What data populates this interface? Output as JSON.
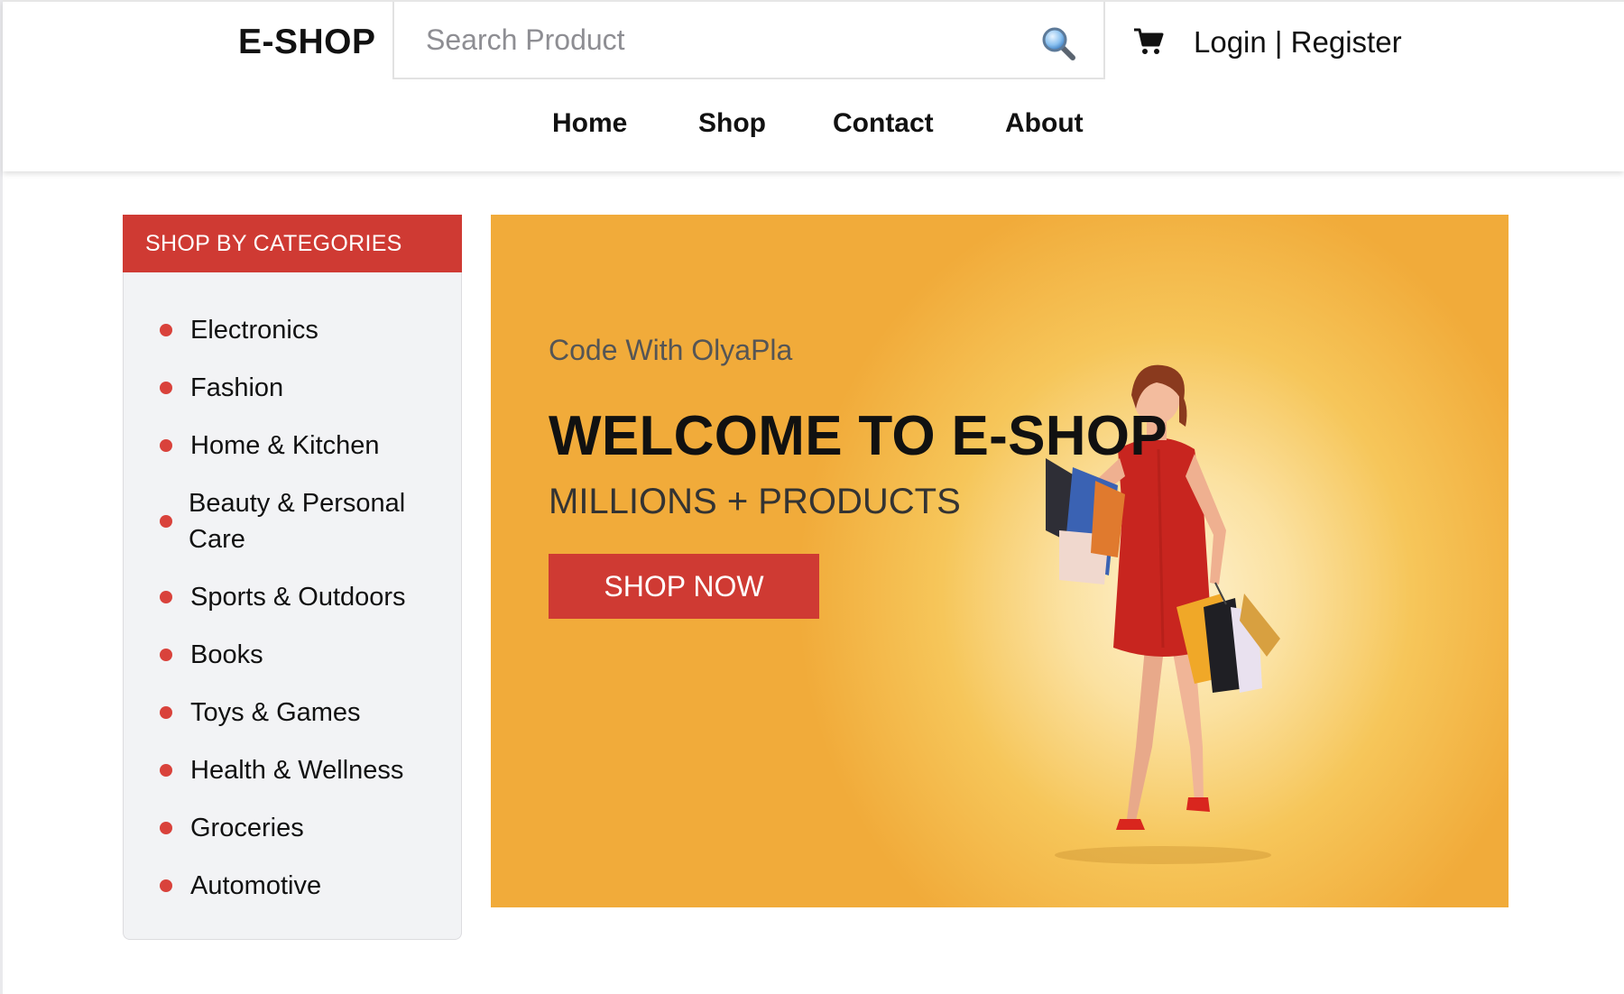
{
  "header": {
    "brand": "E-SHOP",
    "search_placeholder": "Search Product",
    "login_label": "Login",
    "separator": " | ",
    "register_label": "Register"
  },
  "nav": {
    "items": [
      {
        "label": "Home"
      },
      {
        "label": "Shop"
      },
      {
        "label": "Contact"
      },
      {
        "label": "About"
      }
    ]
  },
  "sidebar": {
    "title": "SHOP BY CATEGORIES",
    "categories": [
      {
        "label": "Electronics"
      },
      {
        "label": "Fashion"
      },
      {
        "label": "Home & Kitchen"
      },
      {
        "label": "Beauty & Personal Care"
      },
      {
        "label": "Sports & Outdoors"
      },
      {
        "label": "Books"
      },
      {
        "label": "Toys & Games"
      },
      {
        "label": "Health & Wellness"
      },
      {
        "label": "Groceries"
      },
      {
        "label": "Automotive"
      }
    ]
  },
  "hero": {
    "subtitle": "Code With OlyaPla",
    "title": "WELCOME TO E-SHOP",
    "tagline": "MILLIONS + PRODUCTS",
    "cta_label": "SHOP NOW"
  },
  "colors": {
    "accent": "#cf3a33",
    "hero_background": "#f1ab3a",
    "sidebar_background": "#f2f3f5"
  },
  "icons": [
    "search-icon",
    "cart-icon",
    "category-bullet-icon"
  ]
}
